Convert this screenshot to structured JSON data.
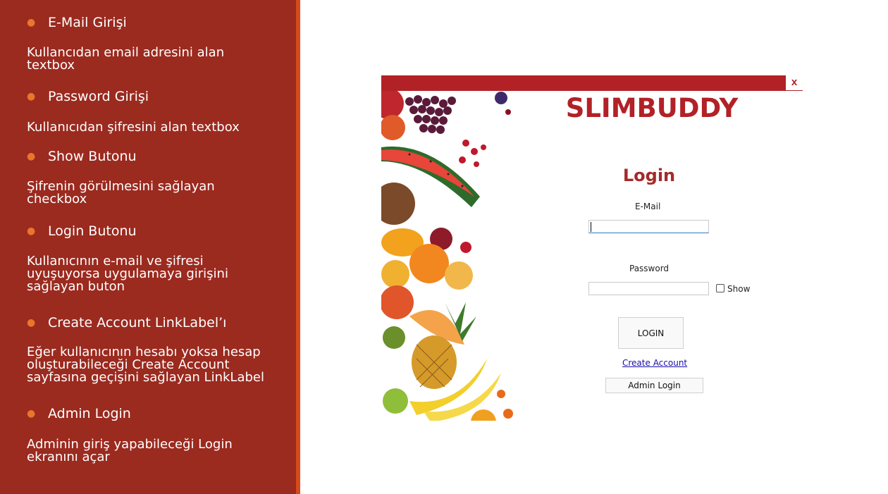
{
  "slide": {
    "items": [
      {
        "title": "E-Mail Girişi",
        "desc": [
          "Kullancıdan email adresini alan",
          "textbox"
        ]
      },
      {
        "title": "Password Girişi",
        "desc": [
          "Kullanıcıdan şifresini alan textbox"
        ]
      },
      {
        "title": "Show Butonu",
        "desc": [
          "Şifrenin görülmesini sağlayan",
          "checkbox"
        ]
      },
      {
        "title": "Login Butonu",
        "desc": [
          "Kullanıcının e-mail ve şifresi",
          "uyuşuyorsa uygulamaya girişini",
          "sağlayan buton"
        ]
      },
      {
        "title": "Create Account LinkLabel’ı",
        "desc": [
          "Eğer kullanıcının hesabı yoksa hesap",
          "oluşturabileceği Create Account",
          "sayfasına geçişini sağlayan LinkLabel"
        ]
      },
      {
        "title": "Admin Login",
        "desc": [
          "Adminin giriş yapabileceği Login",
          "ekranını açar"
        ]
      }
    ],
    "colors": {
      "panel": "#9b2a1f",
      "accent": "#d64a1c",
      "bullet": "#e8762c"
    }
  },
  "window": {
    "close_label": "x",
    "brand": "SLIMBUDDY",
    "login_title": "Login",
    "email_label": "E-Mail",
    "email_value": "",
    "password_label": "Password",
    "password_value": "",
    "show_label": "Show",
    "show_checked": false,
    "login_button": "LOGIN",
    "create_account_link": "Create Account",
    "admin_login_button": "Admin Login",
    "colors": {
      "titlebar": "#b22126",
      "brand": "#b22126",
      "link": "#1a0dab"
    }
  }
}
